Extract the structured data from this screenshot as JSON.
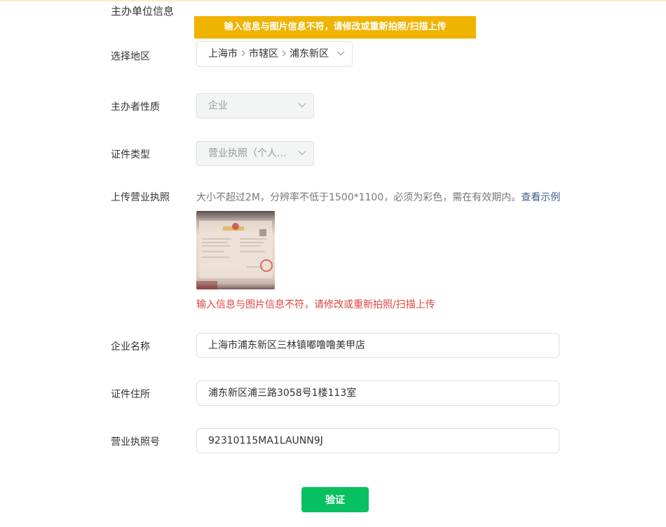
{
  "section_title": "主办单位信息",
  "toast_message": "输入信息与图片信息不符，请修改或重新拍照/扫描上传",
  "region": {
    "label": "选择地区",
    "parts": [
      "上海市",
      "市辖区",
      "浦东新区"
    ]
  },
  "organizer_nature": {
    "label": "主办者性质",
    "value": "企业"
  },
  "certificate_type": {
    "label": "证件类型",
    "value": "营业执照（个人..."
  },
  "upload": {
    "label": "上传营业执照",
    "hint": "大小不超过2M，分辨率不低于1500*1100，必须为彩色，需在有效期内。",
    "example_link": "查看示例",
    "error": "输入信息与图片信息不符，请修改或重新拍照/扫描上传"
  },
  "company_name": {
    "label": "企业名称",
    "value": "上海市浦东新区三林镇嘟噜噜美甲店"
  },
  "certificate_address": {
    "label": "证件住所",
    "value": "浦东新区浦三路3058号1楼113室"
  },
  "license_number": {
    "label": "营业执照号",
    "value": "92310115MA1LAUNN9J"
  },
  "verify_button": "验证",
  "colors": {
    "toast": "#efb300",
    "error": "#e0443e",
    "link": "#3f5f8f",
    "primary_button": "#07c160"
  }
}
